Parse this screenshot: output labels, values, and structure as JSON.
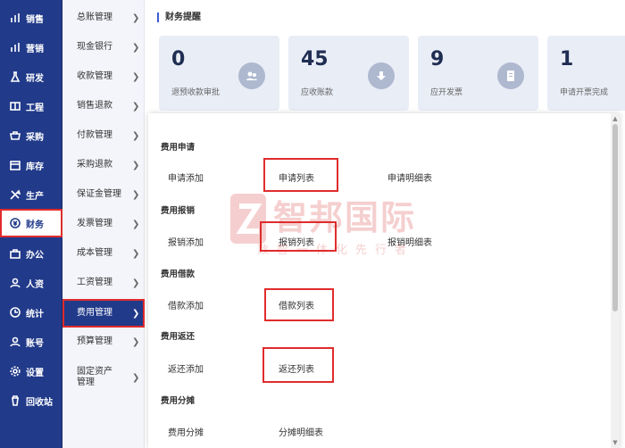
{
  "sidebar": {
    "items": [
      {
        "label": "销售",
        "icon": "bar-chart-icon"
      },
      {
        "label": "营销",
        "icon": "bar-chart-icon"
      },
      {
        "label": "研发",
        "icon": "flask-icon"
      },
      {
        "label": "工程",
        "icon": "book-icon"
      },
      {
        "label": "采购",
        "icon": "cart-icon"
      },
      {
        "label": "库存",
        "icon": "box-icon"
      },
      {
        "label": "生产",
        "icon": "tools-icon"
      },
      {
        "label": "财务",
        "icon": "coin-icon",
        "active": true
      },
      {
        "label": "办公",
        "icon": "briefcase-icon"
      },
      {
        "label": "人资",
        "icon": "user-icon"
      },
      {
        "label": "统计",
        "icon": "clock-icon"
      },
      {
        "label": "账号",
        "icon": "user-icon"
      },
      {
        "label": "设置",
        "icon": "gear-icon"
      },
      {
        "label": "回收站",
        "icon": "trash-icon"
      }
    ]
  },
  "submenu": {
    "items": [
      {
        "label": "总账管理"
      },
      {
        "label": "现金银行"
      },
      {
        "label": "收款管理"
      },
      {
        "label": "销售退款"
      },
      {
        "label": "付款管理"
      },
      {
        "label": "采购退款"
      },
      {
        "label": "保证金管理"
      },
      {
        "label": "发票管理"
      },
      {
        "label": "成本管理"
      },
      {
        "label": "工资管理"
      },
      {
        "label": "费用管理",
        "active": true
      },
      {
        "label": "预算管理"
      },
      {
        "label": "固定资产\n管理"
      }
    ]
  },
  "finance": {
    "title": "财务提醒",
    "cards": [
      {
        "value": "0",
        "caption": "退预收款审批"
      },
      {
        "value": "45",
        "caption": "应收账款"
      },
      {
        "value": "9",
        "caption": "应开发票"
      },
      {
        "value": "1",
        "caption": "申请开票完成"
      }
    ]
  },
  "panel": {
    "sections": [
      {
        "title": "费用申请",
        "links": [
          "申请添加",
          "申请列表",
          "申请明细表"
        ]
      },
      {
        "title": "费用报销",
        "links": [
          "报销添加",
          "报销列表",
          "报销明细表"
        ]
      },
      {
        "title": "费用借款",
        "links": [
          "借款添加",
          "借款列表"
        ]
      },
      {
        "title": "费用返还",
        "links": [
          "返还添加",
          "返还列表"
        ]
      },
      {
        "title": "费用分摊",
        "links": [
          "费用分摊",
          "分摊明细表"
        ]
      }
    ]
  },
  "watermark": {
    "name": "智邦国际",
    "slogan": "数智一体化先行者"
  },
  "colors": {
    "sidebar": "#213a8a",
    "highlight": "#e02c2c",
    "card": "#e9edf6"
  }
}
